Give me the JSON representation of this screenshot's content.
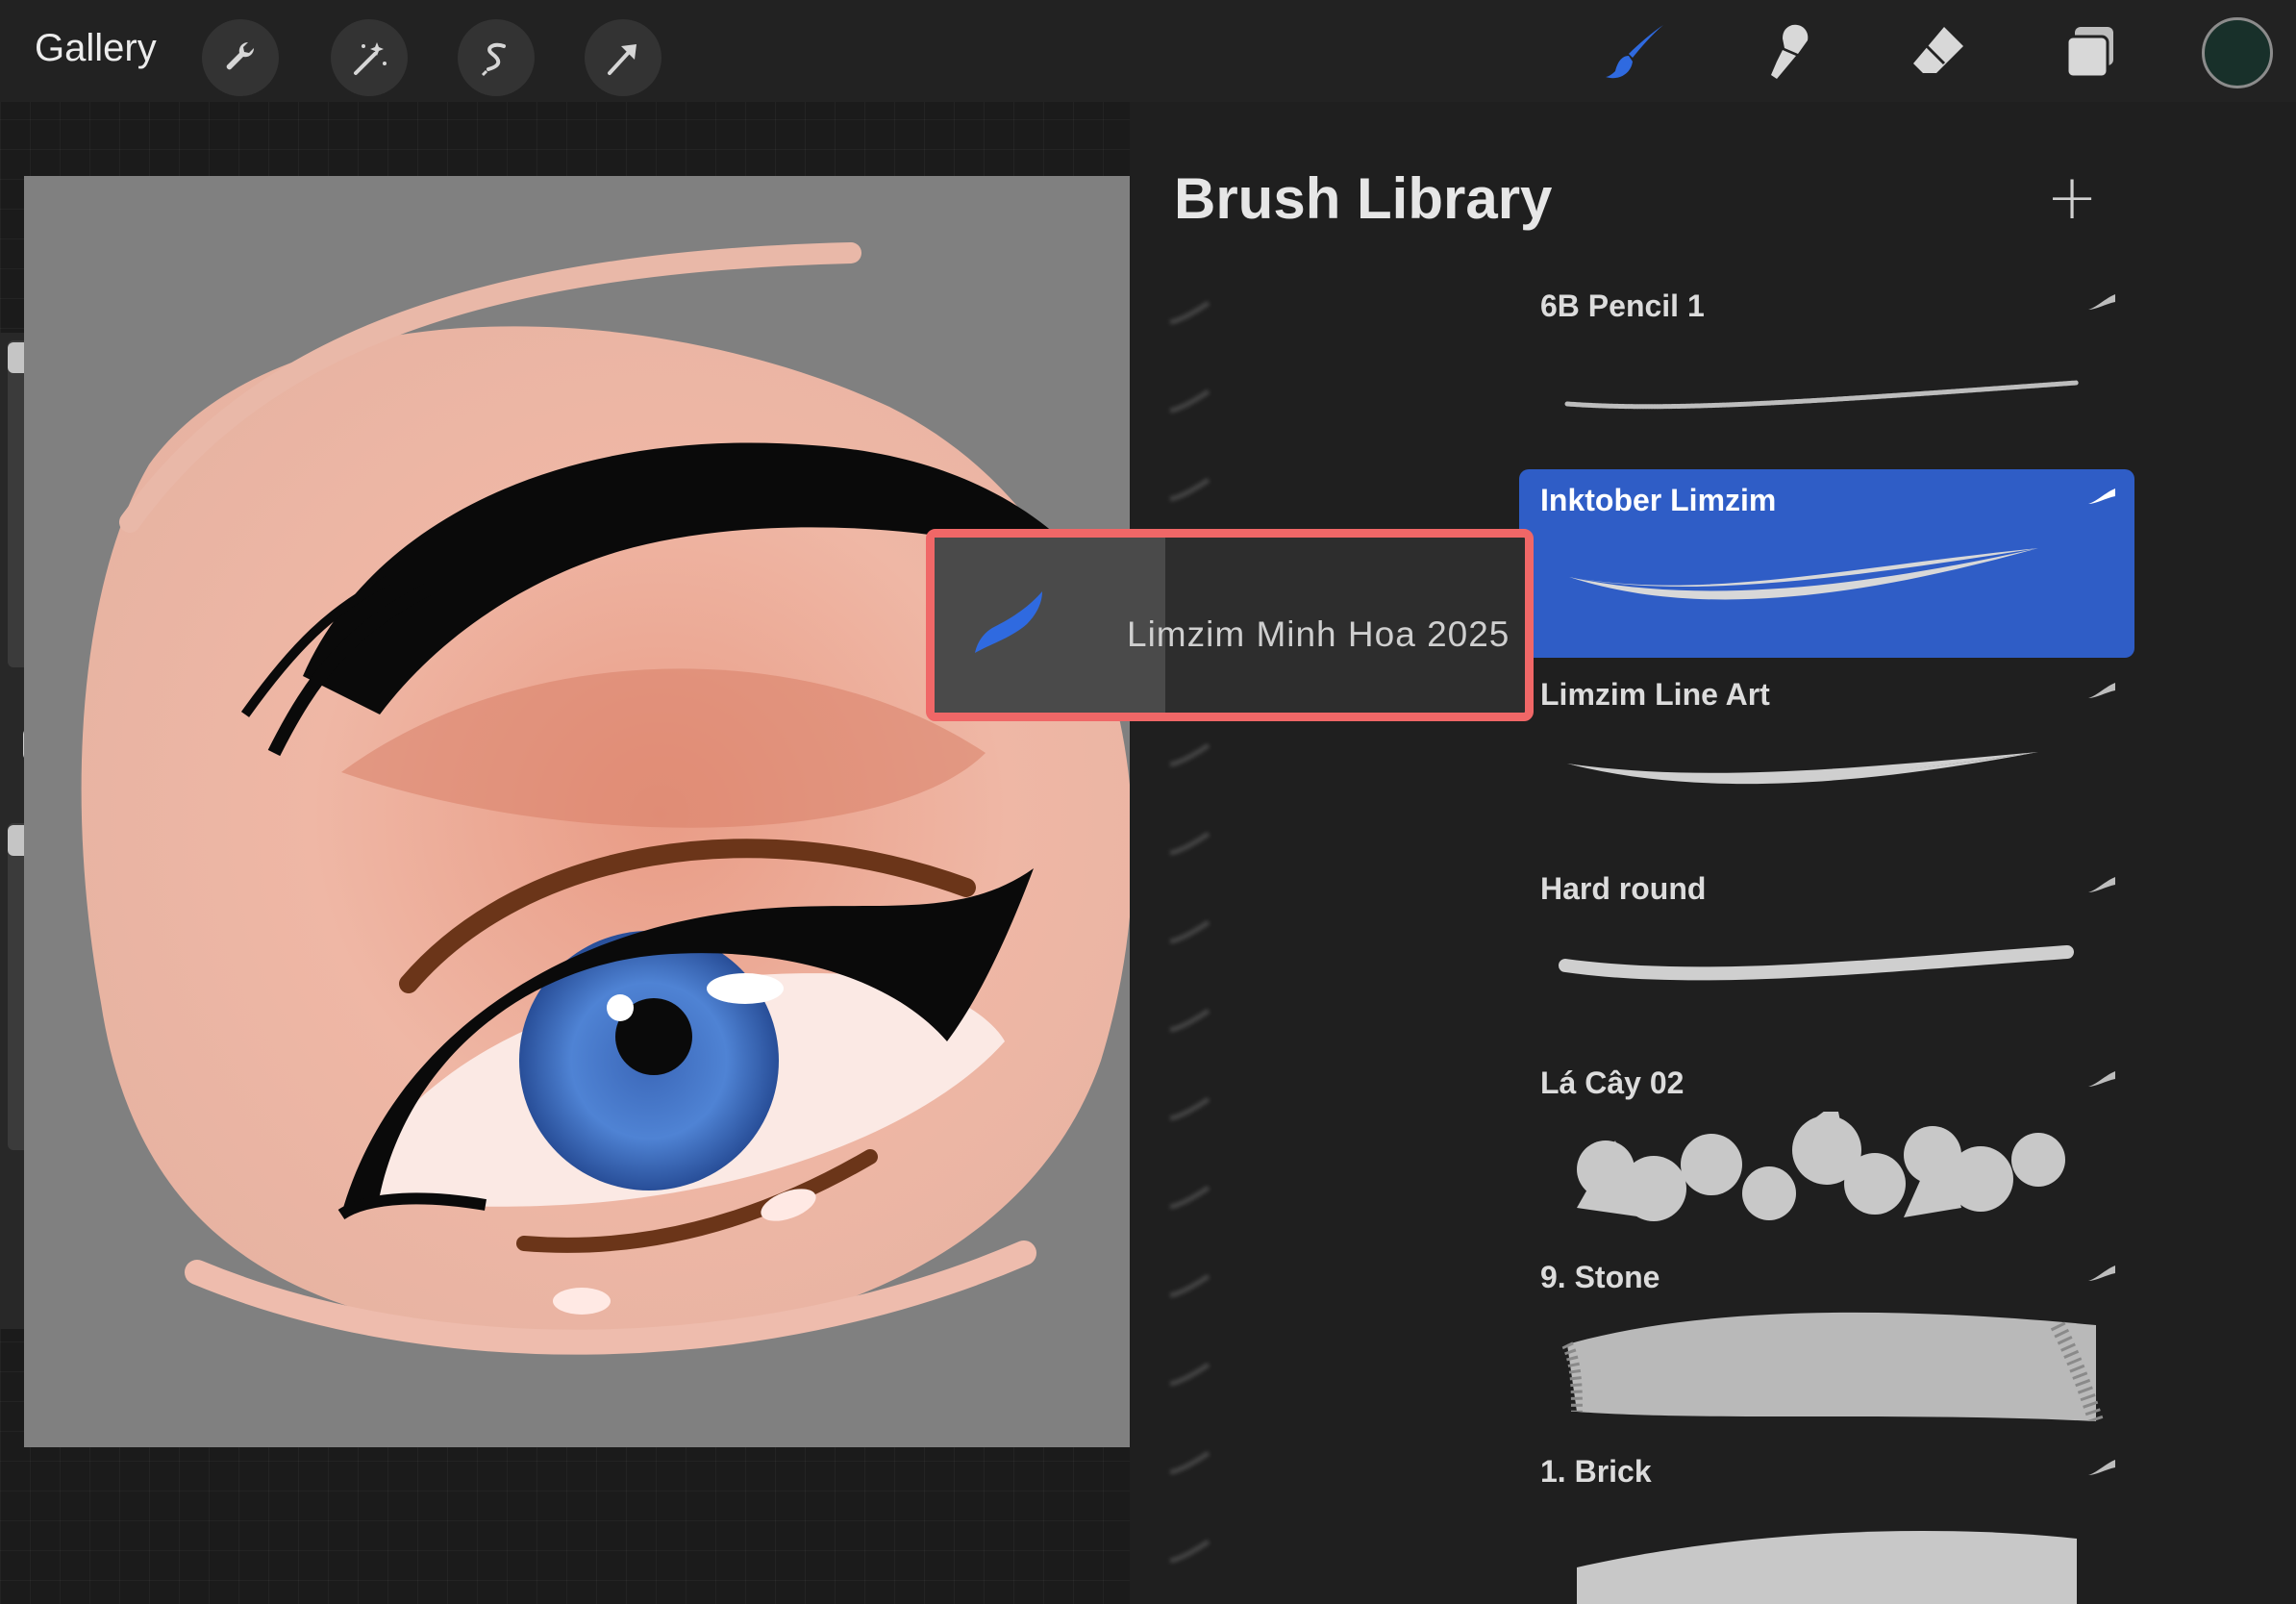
{
  "topbar": {
    "gallery_label": "Gallery",
    "left_tools": [
      "wrench-icon",
      "magic-wand-icon",
      "selection-icon",
      "transform-arrow-icon"
    ],
    "right_tools": [
      "brush-icon",
      "smudge-icon",
      "eraser-icon",
      "layers-icon"
    ],
    "active_tool": "brush-icon",
    "active_tool_color": "#2f6ae0",
    "current_color": "#18302a"
  },
  "sidebar": {
    "size_slider_level": 0.95,
    "opacity_slider_level": 0.95,
    "undo_icon": "undo-arrow-icon",
    "redo_icon": "redo-arrow-icon"
  },
  "brush_library": {
    "title": "Brush Library",
    "add_button": "+",
    "brushes": [
      {
        "name": "6B Pencil 1",
        "selected": false
      },
      {
        "name": "Inktober Limzim",
        "selected": true
      },
      {
        "name": "Limzim Line Art",
        "selected": false
      },
      {
        "name": "Hard round",
        "selected": false
      },
      {
        "name": "Lá Cây 02",
        "selected": false
      },
      {
        "name": "9. Stone",
        "selected": false
      },
      {
        "name": "1. Brick",
        "selected": false
      }
    ],
    "selection_color": "#2f5dc6"
  },
  "drag_tile": {
    "label": "Limzim Minh Hoa 2025",
    "highlight_color": "#f06767"
  }
}
